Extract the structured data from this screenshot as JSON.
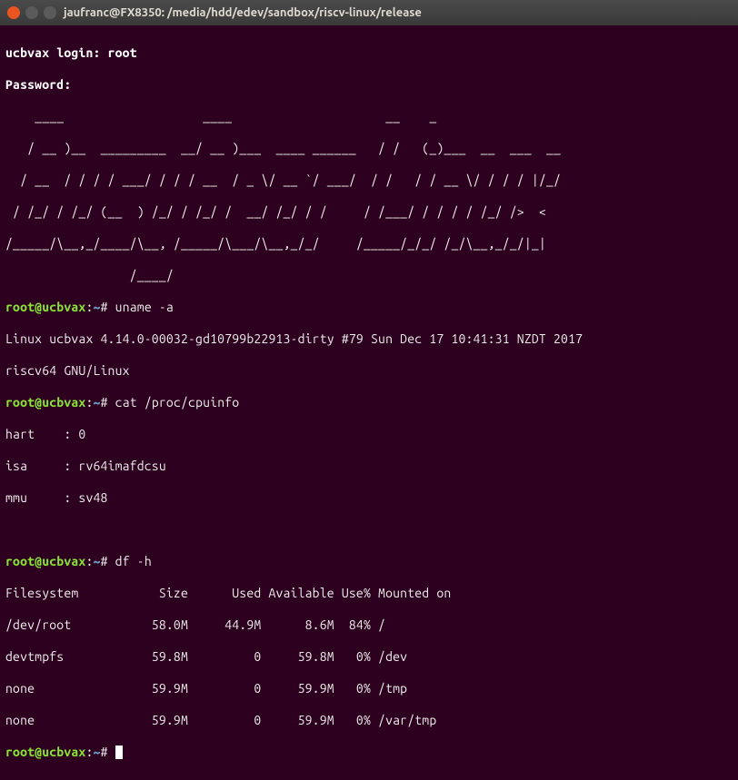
{
  "window": {
    "title": "jaufranc@FX8350: /media/hdd/edev/sandbox/riscv-linux/release"
  },
  "session": {
    "login_prompt": "ucbvax login: root",
    "password_prompt": "Password:",
    "ascii_art": [
      "    ____                   ____                     __    _",
      "   / __ )__  _________  __/ __ )___  ____ ______   / /   (_)___  __  ___  __",
      "  / __  / / / / ___/ / / / __  / _ \\/ __ `/ ___/  / /   / / __ \\/ / / / |/_/",
      " / /_/ / /_/ (__  ) /_/ / /_/ /  __/ /_/ / /     / /___/ / / / / /_/ />  <",
      "/_____/\\__,_/____/\\__, /_____/\\___/\\__,_/_/     /_____/_/_/ /_/\\__,_/_/|_|",
      "                 /____/"
    ],
    "prompts": [
      {
        "user": "root",
        "host": "ucbvax",
        "path": "~",
        "command": "uname -a"
      },
      {
        "user": "root",
        "host": "ucbvax",
        "path": "~",
        "command": "cat /proc/cpuinfo"
      },
      {
        "user": "root",
        "host": "ucbvax",
        "path": "~",
        "command": "df -h"
      },
      {
        "user": "root",
        "host": "ucbvax",
        "path": "~",
        "command": ""
      }
    ],
    "uname_output": [
      "Linux ucbvax 4.14.0-00032-gd10799b22913-dirty #79 Sun Dec 17 10:41:31 NZDT 2017",
      "riscv64 GNU/Linux"
    ],
    "cpuinfo_output": [
      "hart    : 0",
      "isa     : rv64imafdcsu",
      "mmu     : sv48"
    ],
    "df_header": "Filesystem           Size      Used Available Use% Mounted on",
    "df_rows": [
      "/dev/root           58.0M     44.9M      8.6M  84% /",
      "devtmpfs            59.8M         0     59.8M   0% /dev",
      "none                59.9M         0     59.9M   0% /tmp",
      "none                59.9M         0     59.9M   0% /var/tmp"
    ]
  }
}
